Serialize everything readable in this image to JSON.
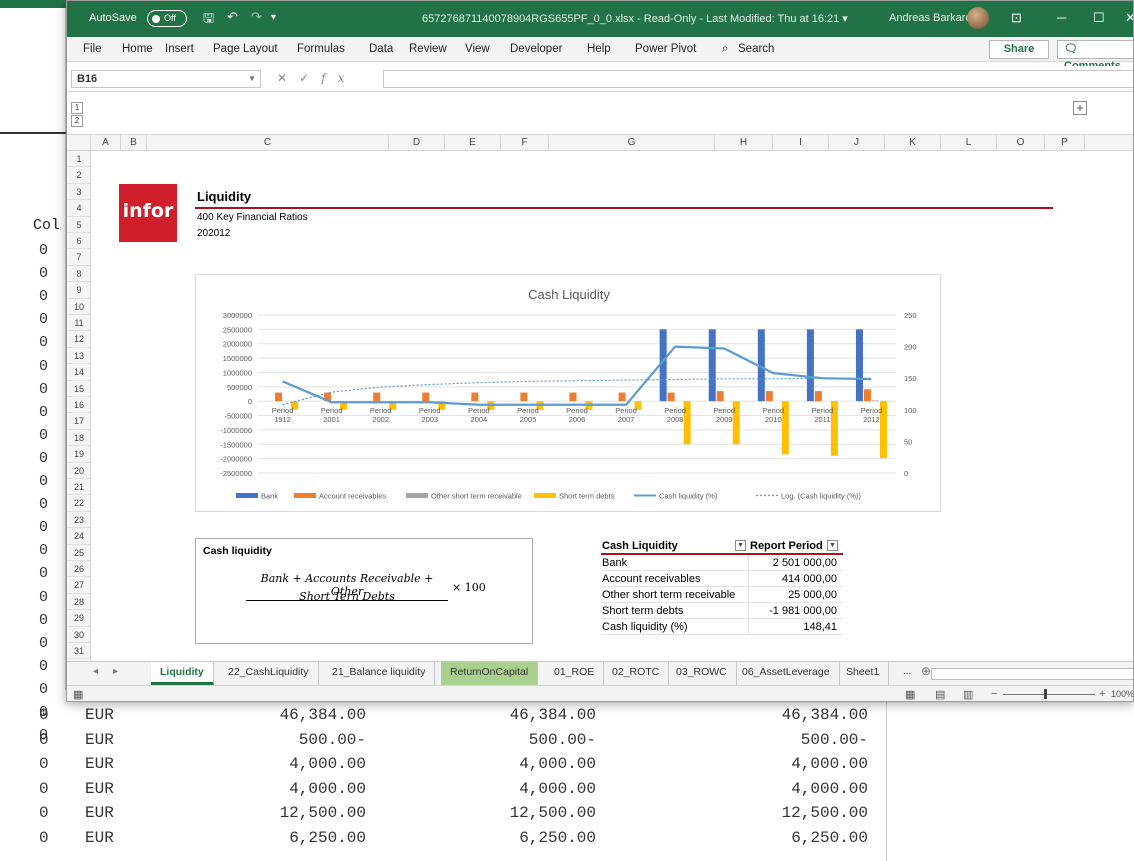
{
  "background": {
    "column_header": "Col",
    "zero_value": "0",
    "rows": [
      {
        "zero": "0",
        "currency": "EUR",
        "v1": "46,384.00",
        "v2": "46,384.00",
        "v3": "46,384.00"
      },
      {
        "zero": "0",
        "currency": "EUR",
        "v1": "500.00-",
        "v2": "500.00-",
        "v3": "500.00-"
      },
      {
        "zero": "0",
        "currency": "EUR",
        "v1": "4,000.00",
        "v2": "4,000.00",
        "v3": "4,000.00"
      },
      {
        "zero": "0",
        "currency": "EUR",
        "v1": "4,000.00",
        "v2": "4,000.00",
        "v3": "4,000.00"
      },
      {
        "zero": "0",
        "currency": "EUR",
        "v1": "12,500.00",
        "v2": "12,500.00",
        "v3": "12,500.00"
      },
      {
        "zero": "0",
        "currency": "EUR",
        "v1": "6,250.00",
        "v2": "6,250.00",
        "v3": "6,250.00"
      }
    ]
  },
  "titlebar": {
    "autosave": "AutoSave",
    "autosave_state": "Off",
    "filename": "657276871140078904RGS655PF_0_0.xlsx  -  Read-Only  -  Last Modified: Thu at 16:21  ▾",
    "user": "Andreas Barkaro"
  },
  "menu": {
    "items": [
      "File",
      "Home",
      "Insert",
      "Page Layout",
      "Formulas",
      "Data",
      "Review",
      "View",
      "Developer",
      "Help",
      "Power Pivot"
    ],
    "search": "Search",
    "share": "Share",
    "comments": "Comments"
  },
  "formula_bar": {
    "name_box": "B16",
    "fx": "fx",
    "value": ""
  },
  "outline": {
    "level1": "1",
    "level2": "2",
    "expand": "+"
  },
  "columns": [
    "A",
    "B",
    "C",
    "D",
    "E",
    "F",
    "G",
    "H",
    "I",
    "J",
    "K",
    "L",
    "O",
    "P"
  ],
  "rows": [
    "1",
    "2",
    "3",
    "4",
    "5",
    "6",
    "7",
    "8",
    "9",
    "10",
    "11",
    "12",
    "13",
    "14",
    "15",
    "16",
    "17",
    "18",
    "19",
    "20",
    "21",
    "22",
    "23",
    "24",
    "25",
    "26",
    "27",
    "28",
    "29",
    "30",
    "31"
  ],
  "sheet": {
    "logo": "infor",
    "title": "Liquidity",
    "subtitle": "400 Key Financial Ratios",
    "period": "202012"
  },
  "chart_data": {
    "type": "bar",
    "title": "Cash Liquidity",
    "categories": [
      "Period 1912",
      "Period 2001",
      "Period 2002",
      "Period 2003",
      "Period 2004",
      "Period 2005",
      "Period 2006",
      "Period 2007",
      "Period 2008",
      "Period 2009",
      "Period 2010",
      "Period 2011",
      "Period 2012"
    ],
    "ylim": [
      -2500000,
      3000000
    ],
    "y_ticks": [
      3000000,
      2500000,
      2000000,
      1500000,
      1000000,
      500000,
      0,
      -500000,
      -1000000,
      -1500000,
      -2000000,
      -2500000
    ],
    "y2lim": [
      0,
      250
    ],
    "y2_ticks": [
      250,
      200,
      150,
      100,
      50,
      0
    ],
    "series": [
      {
        "name": "Bank",
        "axis": "primary",
        "kind": "bar",
        "color": "#4472c4",
        "values": [
          0,
          0,
          0,
          0,
          0,
          0,
          0,
          0,
          2500000,
          2500000,
          2500000,
          2500000,
          2500000
        ]
      },
      {
        "name": "Account receivables",
        "axis": "primary",
        "kind": "bar",
        "color": "#ed7d31",
        "values": [
          300000,
          300000,
          300000,
          300000,
          300000,
          300000,
          300000,
          300000,
          300000,
          350000,
          350000,
          350000,
          414000
        ]
      },
      {
        "name": "Other short term receivable",
        "axis": "primary",
        "kind": "bar",
        "color": "#a5a5a5",
        "values": [
          0,
          0,
          0,
          0,
          0,
          0,
          0,
          0,
          0,
          0,
          0,
          0,
          25000
        ]
      },
      {
        "name": "Short term debts",
        "axis": "primary",
        "kind": "bar",
        "color": "#ffc000",
        "values": [
          -300000,
          -300000,
          -300000,
          -300000,
          -300000,
          -300000,
          -300000,
          -300000,
          -1500000,
          -1500000,
          -1850000,
          -1900000,
          -1981000
        ]
      },
      {
        "name": "Cash liquidity (%)",
        "axis": "secondary",
        "kind": "line",
        "color": "#5b9bd5",
        "values": [
          145,
          112,
          112,
          112,
          108,
          108,
          108,
          108,
          200,
          197,
          158,
          150,
          148.41
        ]
      },
      {
        "name": "Log. (Cash liquidity (%))",
        "axis": "secondary",
        "kind": "trend",
        "color": "#5b9bd5",
        "values": [
          108,
          128,
          136,
          140,
          143,
          145,
          146,
          147,
          148,
          149,
          149,
          150,
          150
        ]
      }
    ],
    "legend": "bottom"
  },
  "formula": {
    "title": "Cash liquidity",
    "numerator": "Bank + Accounts Receivable + Other",
    "denominator": "Short Tern Debts",
    "multiplier": "× 100"
  },
  "pivot": {
    "header_label": "Cash Liquidity",
    "header_value": "Report Period",
    "rows": [
      {
        "label": "Bank",
        "value": "2 501 000,00"
      },
      {
        "label": "Account receivables",
        "value": "414 000,00"
      },
      {
        "label": "Other short term receivable",
        "value": "25 000,00"
      },
      {
        "label": "Short term debts",
        "value": "-1 981 000,00"
      },
      {
        "label": "Cash liquidity (%)",
        "value": "148,41"
      }
    ]
  },
  "tabs": [
    {
      "label": "Liquidity",
      "state": "active"
    },
    {
      "label": "22_CashLiquidity",
      "state": "normal"
    },
    {
      "label": "21_Balance liquidity",
      "state": "normal"
    },
    {
      "label": "ReturnOnCapital",
      "state": "green"
    },
    {
      "label": "01_ROE",
      "state": "normal"
    },
    {
      "label": "02_ROTC",
      "state": "normal"
    },
    {
      "label": "03_ROWC",
      "state": "normal"
    },
    {
      "label": "06_AssetLeverage",
      "state": "normal"
    },
    {
      "label": "Sheet1",
      "state": "normal"
    }
  ],
  "tab_more": "...",
  "status": {
    "zoom": "100%"
  }
}
